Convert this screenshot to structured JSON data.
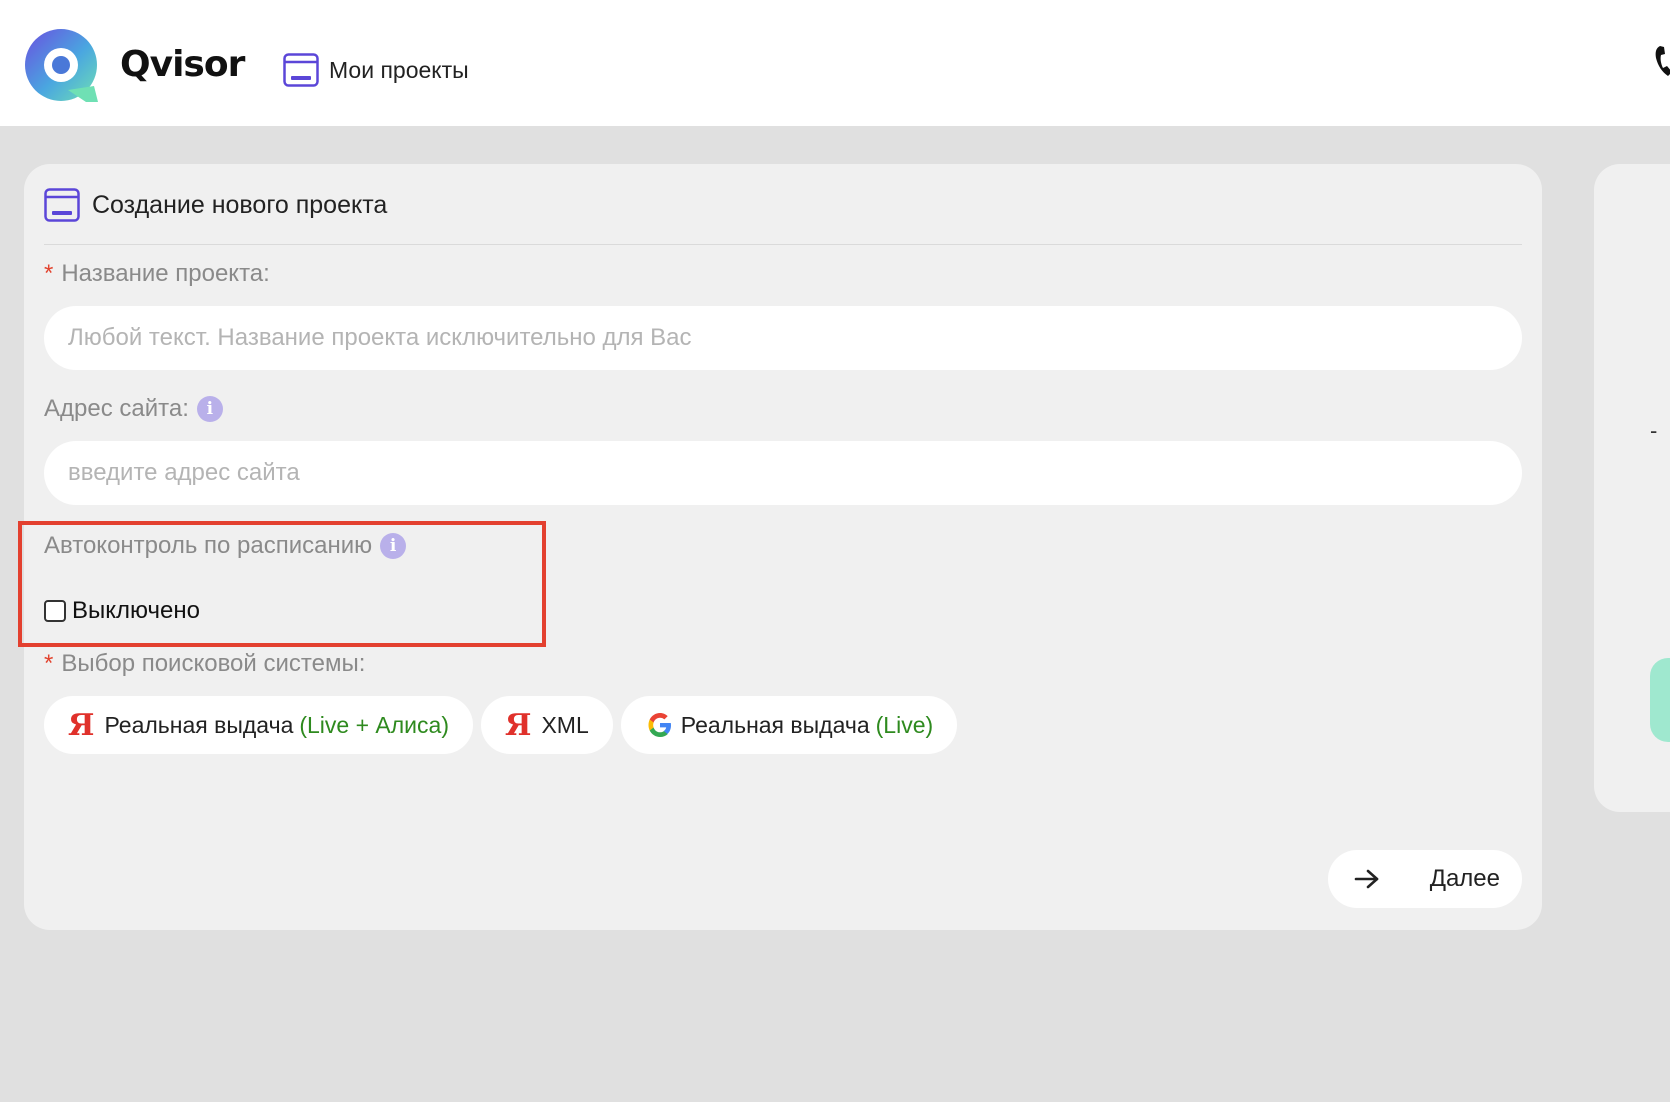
{
  "header": {
    "brand": "Qvisor",
    "nav_projects": "Мои проекты"
  },
  "form": {
    "title": "Создание нового проекта",
    "project_name": {
      "required_mark": "*",
      "label": "Название проекта:",
      "placeholder": "Любой текст. Название проекта исключительно для Вас",
      "value": ""
    },
    "site_address": {
      "label": "Адрес сайта:",
      "placeholder": "введите адрес сайта",
      "value": ""
    },
    "autocontrol": {
      "label": "Автоконтроль по расписанию",
      "checkbox_label": "Выключено",
      "checked": false
    },
    "search_engine": {
      "required_mark": "*",
      "label": "Выбор поисковой системы:",
      "options": [
        {
          "icon": "yandex-icon",
          "logo": "Я",
          "text": "Реальная выдача",
          "suffix": "(Live + Алиса)"
        },
        {
          "icon": "yandex-icon",
          "logo": "Я",
          "text": "XML",
          "suffix": ""
        },
        {
          "icon": "google-icon",
          "text": "Реальная выдача",
          "suffix": "(Live)"
        }
      ]
    },
    "next_label": "Далее"
  },
  "side": {
    "dash": "-"
  },
  "colors": {
    "accent": "#5b46d8",
    "required": "#e2442f",
    "highlight": "#e3402f",
    "live_green": "#2e8a1e",
    "yandex_red": "#e0312b"
  }
}
